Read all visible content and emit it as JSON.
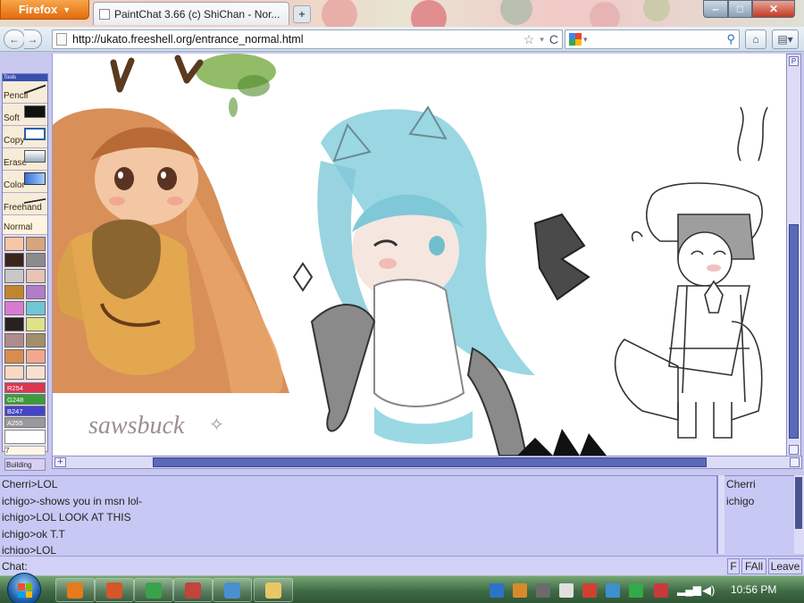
{
  "browser": {
    "menu_button_label": "Firefox",
    "tab_title": "PaintChat 3.66 (c) ShiChan - Nor...",
    "new_tab_label": "+",
    "url": "http://ukato.freeshell.org/entrance_normal.html",
    "window_controls": {
      "minimize": "‒",
      "maximize": "□",
      "close": "✕"
    },
    "nav": {
      "back": "←",
      "forward": "→",
      "reload": "C",
      "home": "⌂"
    }
  },
  "toolbox": {
    "header": "Tools",
    "tools": [
      {
        "label": "Pencil",
        "icon": "pencil-icon"
      },
      {
        "label": "Soft",
        "icon": "soft-brush-icon"
      },
      {
        "label": "Copy",
        "icon": "copy-icon"
      },
      {
        "label": "Erase",
        "icon": "eraser-icon"
      },
      {
        "label": "Color",
        "icon": "color-icon"
      },
      {
        "label": "Freehand",
        "icon": "freehand-icon"
      }
    ],
    "mode_label": "Normal",
    "palette": [
      "#f6c6a6",
      "#d6a57e",
      "#3b241c",
      "#8b8b8b",
      "#c8c8c8",
      "#e7c4b5",
      "#c2852f",
      "#b27cc9",
      "#d97ad2",
      "#6fc7d4",
      "#2a2020",
      "#dde386",
      "#b08b8b",
      "#a08f6a",
      "#d88d4f",
      "#f3a88e",
      "#f8d8c3",
      "#f7e0d0"
    ],
    "rgba": [
      {
        "label": "R254",
        "color": "#d9384e"
      },
      {
        "label": "G248",
        "color": "#3b9c3b"
      },
      {
        "label": "B247",
        "color": "#4444c8"
      },
      {
        "label": "A255",
        "color": "#9a9a9a"
      }
    ],
    "brush_size": "7",
    "status_label": "Building"
  },
  "canvas": {
    "signature_text": "sawsbuck"
  },
  "chat": {
    "messages": [
      "Cherri>LOL",
      "ichigo>-shows you in msn lol-",
      "ichigo>LOL LOOK AT THIS",
      "ichigo>ok T.T",
      "ichigo>LOL"
    ],
    "users": [
      "Cherri",
      "ichigo"
    ],
    "input_label": "Chat:",
    "input_value": "",
    "buttons": {
      "f": "F",
      "fall": "FAll",
      "leave": "Leave"
    }
  },
  "taskbar": {
    "clock": "10:56 PM",
    "apps": [
      {
        "name": "firefox-taskbar-icon",
        "color": "#e57a1e"
      },
      {
        "name": "media-player-icon",
        "color": "#d4572a"
      },
      {
        "name": "game-app-icon",
        "color": "#3aa24a"
      },
      {
        "name": "image-app-icon",
        "color": "#c0453c"
      },
      {
        "name": "network-app-icon",
        "color": "#4a8fd0"
      },
      {
        "name": "file-explorer-icon",
        "color": "#e9c765"
      }
    ]
  },
  "colors": {
    "panel_bg": "#c8c8ef",
    "scroll_thumb": "#5c68b8",
    "firefox_orange": "#e36b0c"
  }
}
